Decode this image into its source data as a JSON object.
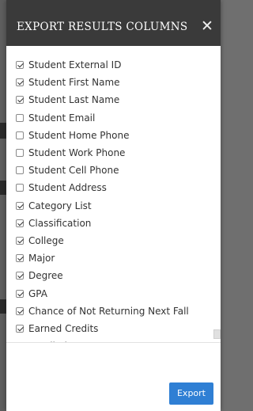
{
  "modal": {
    "title": "EXPORT RESULTS COLUMNS",
    "close_glyph": "✕",
    "export_label": "Export"
  },
  "columns": [
    {
      "label": "Student External ID",
      "checked": true
    },
    {
      "label": "Student First Name",
      "checked": true
    },
    {
      "label": "Student Last Name",
      "checked": true
    },
    {
      "label": "Student Email",
      "checked": false
    },
    {
      "label": "Student Home Phone",
      "checked": false
    },
    {
      "label": "Student Work Phone",
      "checked": false
    },
    {
      "label": "Student Cell Phone",
      "checked": false
    },
    {
      "label": "Student Address",
      "checked": false
    },
    {
      "label": "Category List",
      "checked": true
    },
    {
      "label": "Classification",
      "checked": true
    },
    {
      "label": "College",
      "checked": true
    },
    {
      "label": "Major",
      "checked": true
    },
    {
      "label": "Degree",
      "checked": true
    },
    {
      "label": "GPA",
      "checked": true
    },
    {
      "label": "Chance of Not Returning Next Fall",
      "checked": true
    },
    {
      "label": "Earned Credits",
      "checked": true
    },
    {
      "label": "Enrolled",
      "checked": true
    }
  ],
  "colors": {
    "header_bg": "#3a3a3a",
    "accent": "#2f7fd4"
  }
}
